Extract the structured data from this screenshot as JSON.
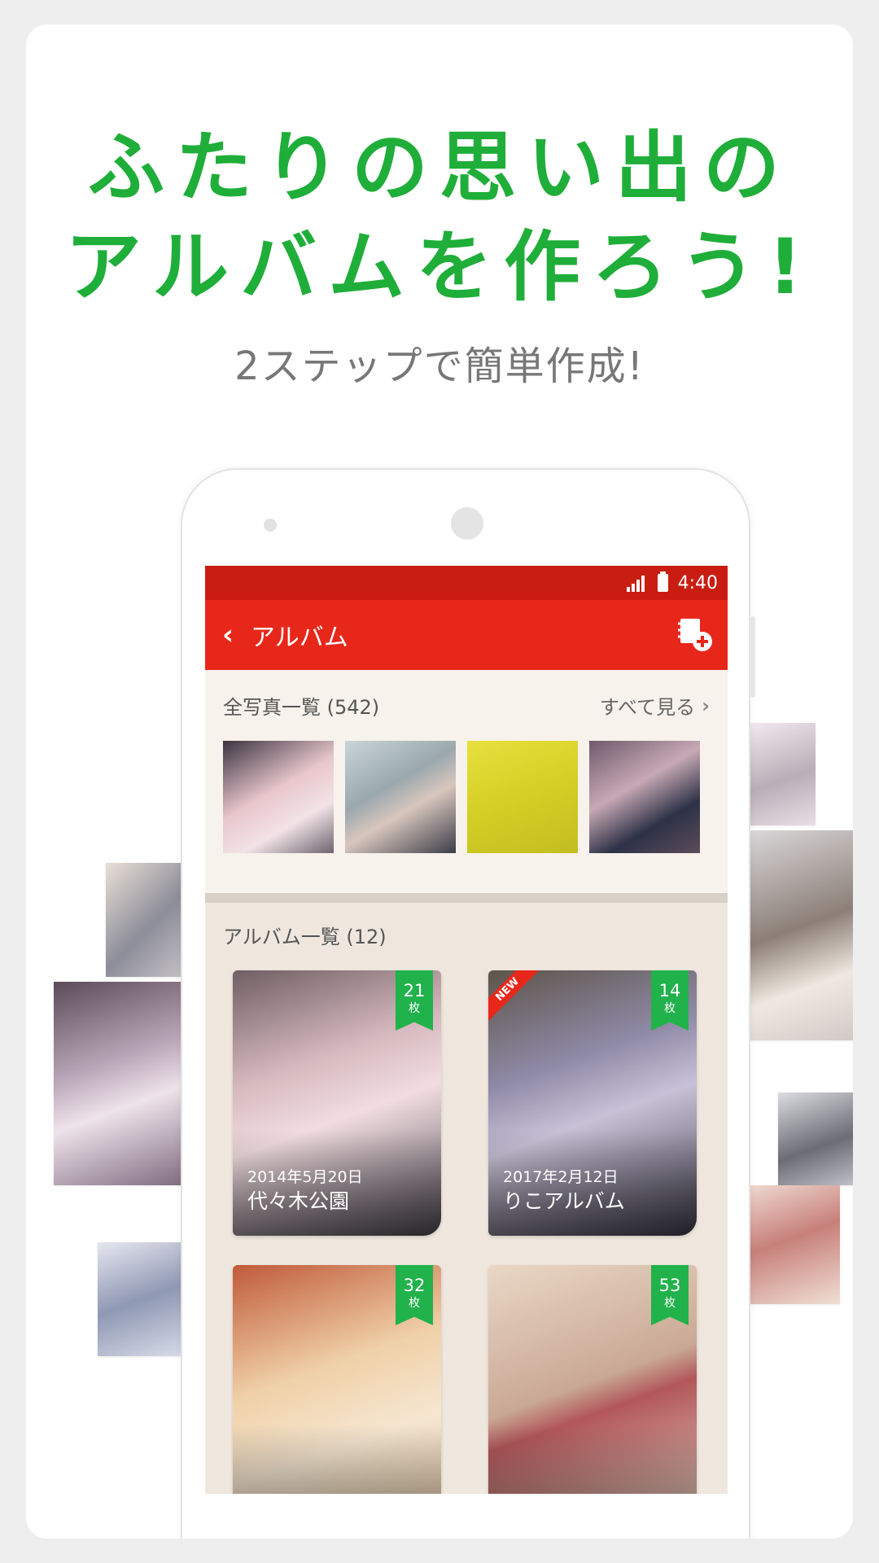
{
  "headline": {
    "line1": "ふたりの思い出の",
    "line2": "アルバムを作ろう!",
    "sub": "2ステップで簡単作成!"
  },
  "status_bar": {
    "time": "4:40"
  },
  "app_bar": {
    "title": "アルバム",
    "back_icon": "chevron-left-icon",
    "action_icon": "album-add-icon"
  },
  "all_photos": {
    "title": "全写真一覧 (542)",
    "see_all": "すべて見る",
    "thumbnails": [
      "couple-selfie",
      "couple-beach",
      "couple-flower-field",
      "couple-kiss-flower"
    ]
  },
  "albums": {
    "title": "アルバム一覧 (12)",
    "items": [
      {
        "count": "21",
        "unit": "枚",
        "date": "2014年5月20日",
        "name": "代々木公園",
        "new": false
      },
      {
        "count": "14",
        "unit": "枚",
        "date": "2017年2月12日",
        "name": "りこアルバム",
        "new": true,
        "new_label": "NEW"
      },
      {
        "count": "32",
        "unit": "枚",
        "date": "",
        "name": "",
        "new": false
      },
      {
        "count": "53",
        "unit": "枚",
        "date": "",
        "name": "",
        "new": false
      }
    ]
  },
  "colors": {
    "headline_green": "#1fae39",
    "appbar_red": "#e8271b",
    "statusbar_red": "#c91d12",
    "badge_green": "#21b24b"
  }
}
